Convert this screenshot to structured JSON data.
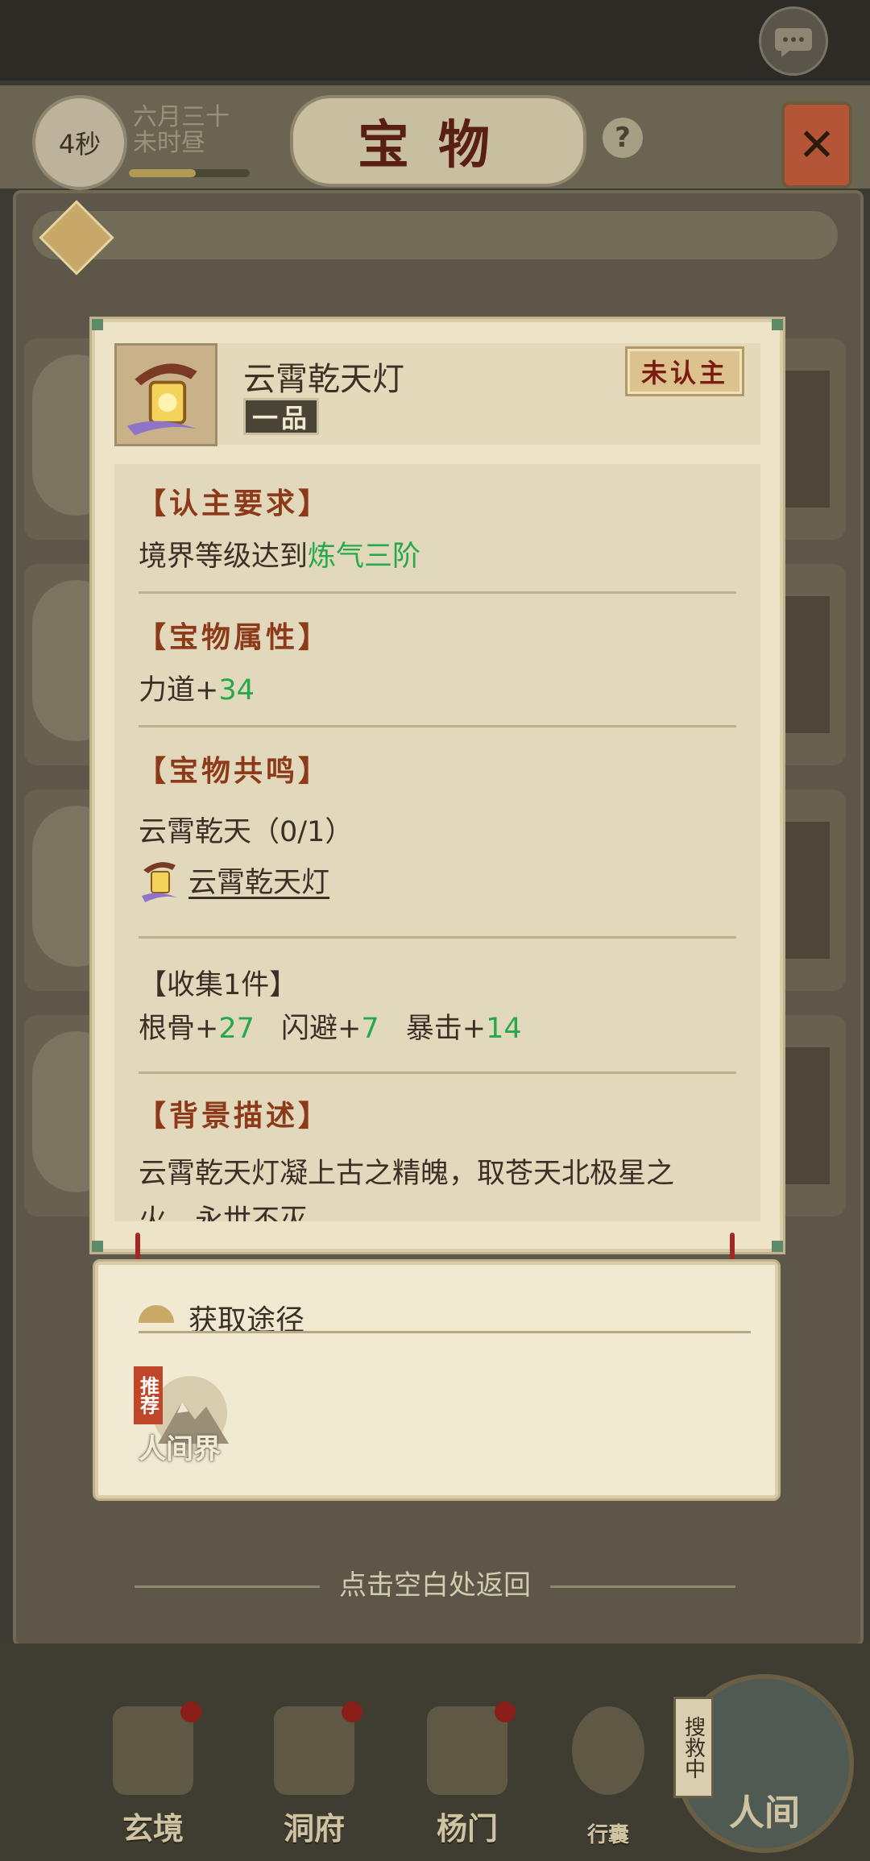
{
  "header": {
    "timer": "4秒",
    "date_line1": "六月三十",
    "date_line2": "未时昼",
    "time_progress": 0.55,
    "title": "宝物",
    "help_label": "?"
  },
  "item": {
    "name": "云霄乾天灯",
    "grade": "一品",
    "status": "未认主"
  },
  "sections": {
    "requirement_title": "【认主要求】",
    "requirement_text": "境界等级达到",
    "requirement_value": "炼气三阶",
    "attr_title": "【宝物属性】",
    "attr_name": "力道+",
    "attr_value": "34",
    "resonance_title": "【宝物共鸣】",
    "set_name": "云霄乾天（0/1）",
    "set_item": "云霄乾天灯",
    "collect_title": "【收集1件】",
    "bonus": [
      {
        "name": "根骨+",
        "value": "27"
      },
      {
        "name": "闪避+",
        "value": "7"
      },
      {
        "name": "暴击+",
        "value": "14"
      }
    ],
    "bg_title": "【背景描述】",
    "bg_text_line1": "云霄乾天灯凝上古之精魄，取苍天北极星之",
    "bg_text_line2": "火，永世不灭"
  },
  "source": {
    "title": "获取途径",
    "recommend": "推荐",
    "world_label": "人间界"
  },
  "hint": "点击空白处返回",
  "dock": {
    "items": [
      "玄境",
      "洞府",
      "杨门",
      "行囊"
    ],
    "world": "人间",
    "search_tag": "搜救中"
  },
  "colors": {
    "accent_green": "#27a84a",
    "section_title": "#8d3a1a",
    "status_text": "#7a1c10"
  }
}
